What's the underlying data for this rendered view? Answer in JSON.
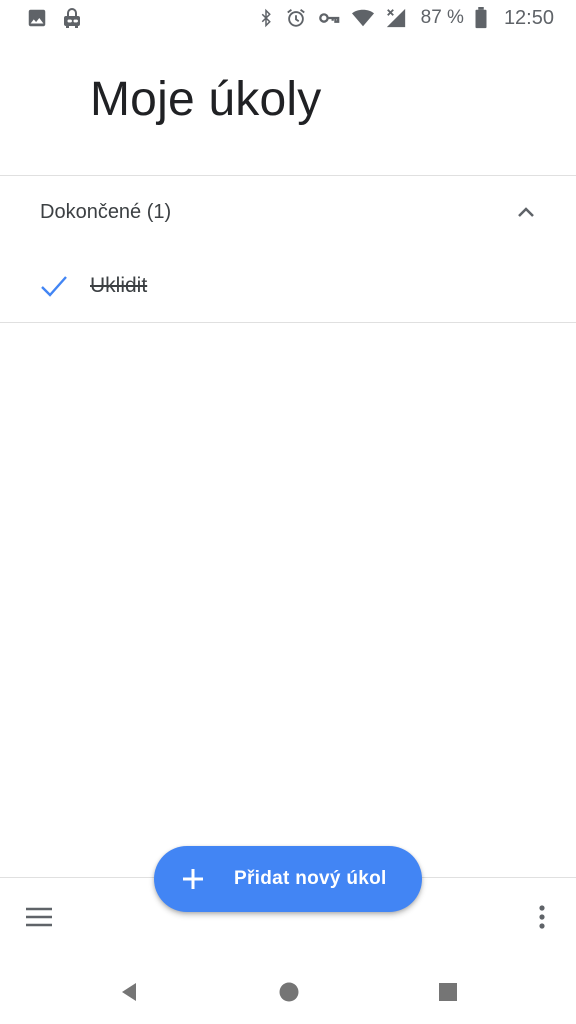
{
  "status_bar": {
    "left_icons": [
      "image-icon",
      "lock-robot-icon"
    ],
    "right_icons": [
      "bluetooth-icon",
      "alarm-icon",
      "vpn-key-icon",
      "wifi-icon",
      "signal-icon",
      "battery-icon"
    ],
    "battery": "87 %",
    "time": "12:50"
  },
  "header": {
    "title": "Moje úkoly"
  },
  "completed_section": {
    "title": "Dokončené (1)",
    "expanded": true,
    "tasks": [
      {
        "label": "Uklidit",
        "done": true
      }
    ]
  },
  "fab": {
    "label": "Přidat nový úkol"
  },
  "colors": {
    "accent": "#4285f4",
    "text_primary": "#202124",
    "text_secondary": "#3c4043",
    "icon_gray": "#5f6368",
    "divider": "#e0e0e0"
  },
  "bottom_bar": {
    "icons": [
      "menu-icon",
      "more-vert-icon"
    ]
  },
  "nav_bar": {
    "icons": [
      "back-icon",
      "home-icon",
      "recents-icon"
    ]
  }
}
